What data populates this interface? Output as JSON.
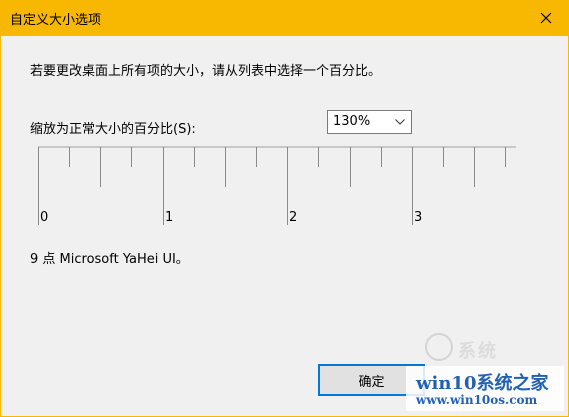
{
  "window": {
    "title": "自定义大小选项",
    "close_icon": "close-icon"
  },
  "dialog": {
    "instruction": "若要更改桌面上所有项的大小，请从列表中选择一个百分比。",
    "scale_label": "缩放为正常大小的百分比(S):",
    "scale_select": {
      "value": "130%"
    },
    "ruler": {
      "labels": [
        "0",
        "1",
        "2",
        "3"
      ]
    },
    "font_info": "9 点 Microsoft YaHei UI。",
    "ok_button": "确定"
  },
  "watermark": {
    "line1": "win10系统之家",
    "line2": "www.win10os.com",
    "faint": "系统"
  },
  "colors": {
    "titlebar": "#f8b700",
    "accent": "#0078d7",
    "watermark": "#2160b3"
  }
}
